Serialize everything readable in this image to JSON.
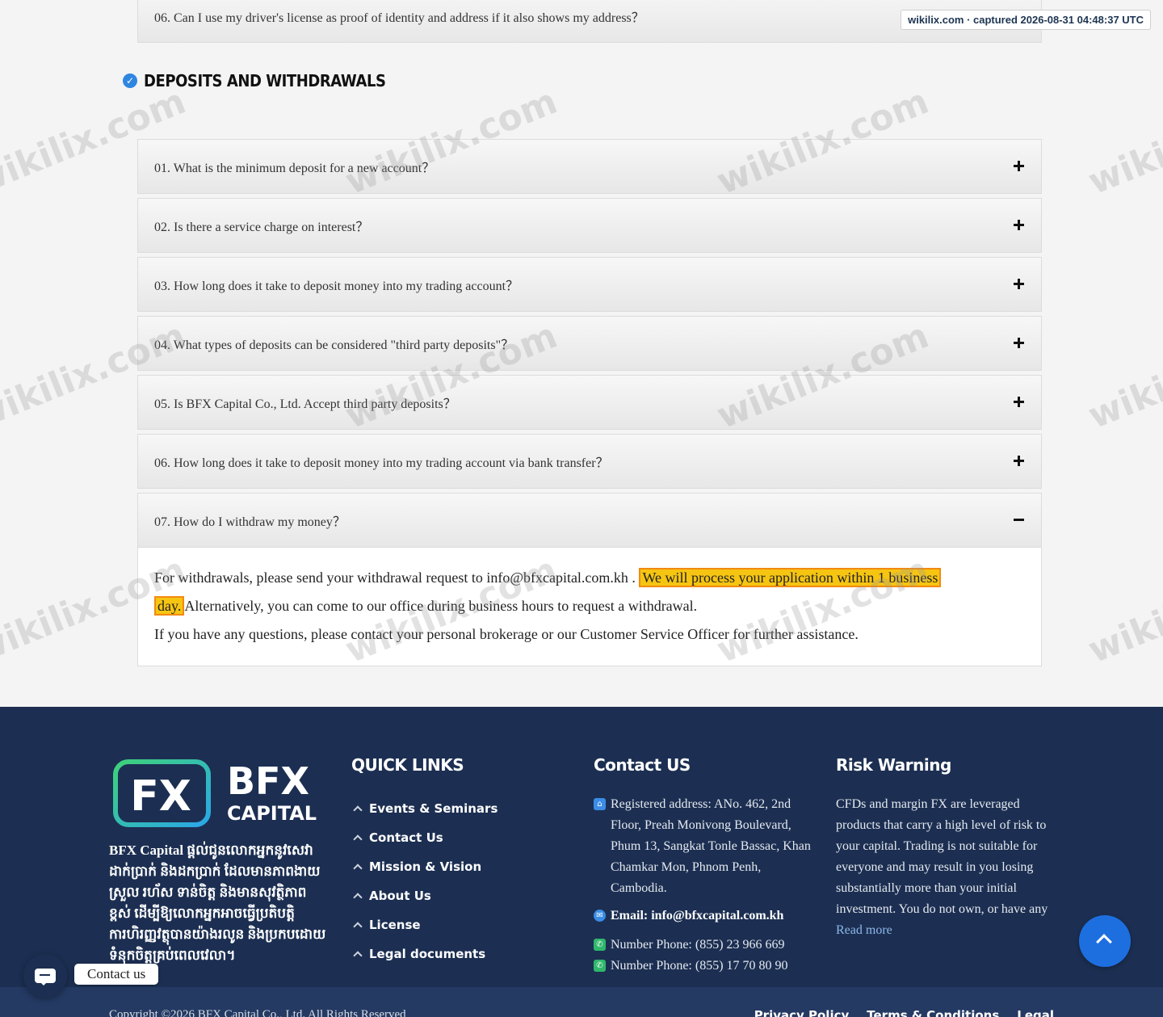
{
  "capture_badge": "wikilix.com · captured 2026-08-31 04:48:37 UTC",
  "watermark": "wikilix.com",
  "prev_faq": {
    "question": "06. Can I use my driver's license as proof of identity and address if it also shows my address？"
  },
  "section": {
    "title": "DEPOSITS AND WITHDRAWALS"
  },
  "faqs": [
    {
      "question": "01. What is the minimum deposit for a new account？",
      "state": "collapsed"
    },
    {
      "question": "02. Is there a service charge on interest？",
      "state": "collapsed"
    },
    {
      "question": "03. How long does it take to deposit money into my trading account？",
      "state": "collapsed"
    },
    {
      "question": "04. What types of deposits can be considered \"third party deposits\"？",
      "state": "collapsed"
    },
    {
      "question": "05. Is BFX Capital Co., Ltd. Accept third party deposits？",
      "state": "collapsed"
    },
    {
      "question": "06. How long does it take to deposit money into my trading account via bank transfer？",
      "state": "collapsed"
    },
    {
      "question": "07. How do I withdraw my money？",
      "state": "expanded"
    }
  ],
  "answer": {
    "part1": "For withdrawals, please send your withdrawal request to info@bfxcapital.com.kh . ",
    "highlight1": "We will process your application within 1 business",
    "highlight2": "day.",
    "part2": "Alternatively, you can come to our office during business hours to request a withdrawal.",
    "part3": "If you have any questions, please contact your personal brokerage or our Customer Service Officer for further assistance."
  },
  "footer": {
    "logo": {
      "mark": "FX",
      "name": "BFX",
      "sub": "CAPITAL"
    },
    "about": "BFX Capital ផ្តល់ជូនលោកអ្នកនូវសេវាដាក់ប្រាក់ និងដកប្រាក់ ដែលមានភាពងាយស្រួល រហ័ស ទាន់ចិត្ត និងមានសុវត្ថិភាពខ្ពស់ ដើម្បីឱ្យលោកអ្នកអាចធ្វើប្រតិបត្តិការហិរញ្ញវត្ថុបានយ៉ាងរលូន និងប្រកបដោយទំនុកចិត្តគ្រប់ពេលវេលា។",
    "quick_links_title": "QUICK LINKS",
    "quick_links": [
      "Events & Seminars",
      "Contact Us",
      "Mission & Vision",
      "About Us",
      "License",
      "Legal documents"
    ],
    "contact_title": "Contact US",
    "address": "Registered address: ANo. 462, 2nd Floor, Preah Monivong Boulevard, Phum 13, Sangkat Tonle Bassac, Khan Chamkar Mon, Phnom Penh, Cambodia.",
    "email": "Email: info@bfxcapital.com.kh",
    "phone1": "Number Phone: (855) 23 966 669",
    "phone2": "Number Phone: (855) 17 70 80 90",
    "risk_title": "Risk Warning",
    "risk_text": "CFDs and margin FX are leveraged products that carry a high level of risk to your capital. Trading is not suitable for everyone and may result in you losing substantially more than your initial investment. You do not own, or have any",
    "read_more": "Read more",
    "copyright": "Copyright ©2026 BFX Capital Co., Ltd. All Rights Reserved",
    "bottom_links": [
      "Privacy Policy",
      "Terms & Conditions",
      "Legal"
    ]
  },
  "chat_label": "Contact us",
  "colors": {
    "footer_bg": "#1c2f52",
    "accent": "#1d6fe0",
    "highlight": "#f6c512",
    "highlight_border": "#f28a10"
  }
}
